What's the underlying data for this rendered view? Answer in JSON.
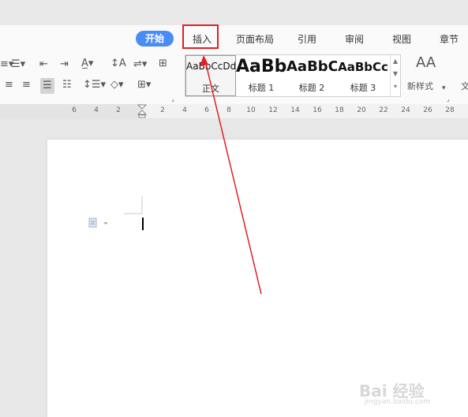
{
  "tabs": [
    {
      "label": "开始",
      "active": true
    },
    {
      "label": "插入",
      "active": false,
      "highlighted": true
    },
    {
      "label": "页面布局",
      "active": false
    },
    {
      "label": "引用",
      "active": false
    },
    {
      "label": "审阅",
      "active": false
    },
    {
      "label": "视图",
      "active": false
    },
    {
      "label": "章节",
      "active": false
    }
  ],
  "styles": [
    {
      "preview": "AaBbCcDd",
      "name": "正文"
    },
    {
      "preview": "AaBb",
      "name": "标题 1"
    },
    {
      "preview": "AaBbC",
      "name": "标题 2"
    },
    {
      "preview": "AaBbCc",
      "name": "标题 3"
    }
  ],
  "new_style_label": "新样式",
  "cut_label": "文",
  "ruler": {
    "ticks": [
      "6",
      "4",
      "2",
      "2",
      "4",
      "6",
      "8",
      "10",
      "12",
      "14",
      "16",
      "18",
      "20",
      "22",
      "24",
      "26",
      "28"
    ]
  },
  "watermark": {
    "text": "Bai 经验",
    "sub": "jingyan.baidu.com"
  },
  "colors": {
    "accent": "#4a8cf7",
    "annotation": "#e02020"
  }
}
